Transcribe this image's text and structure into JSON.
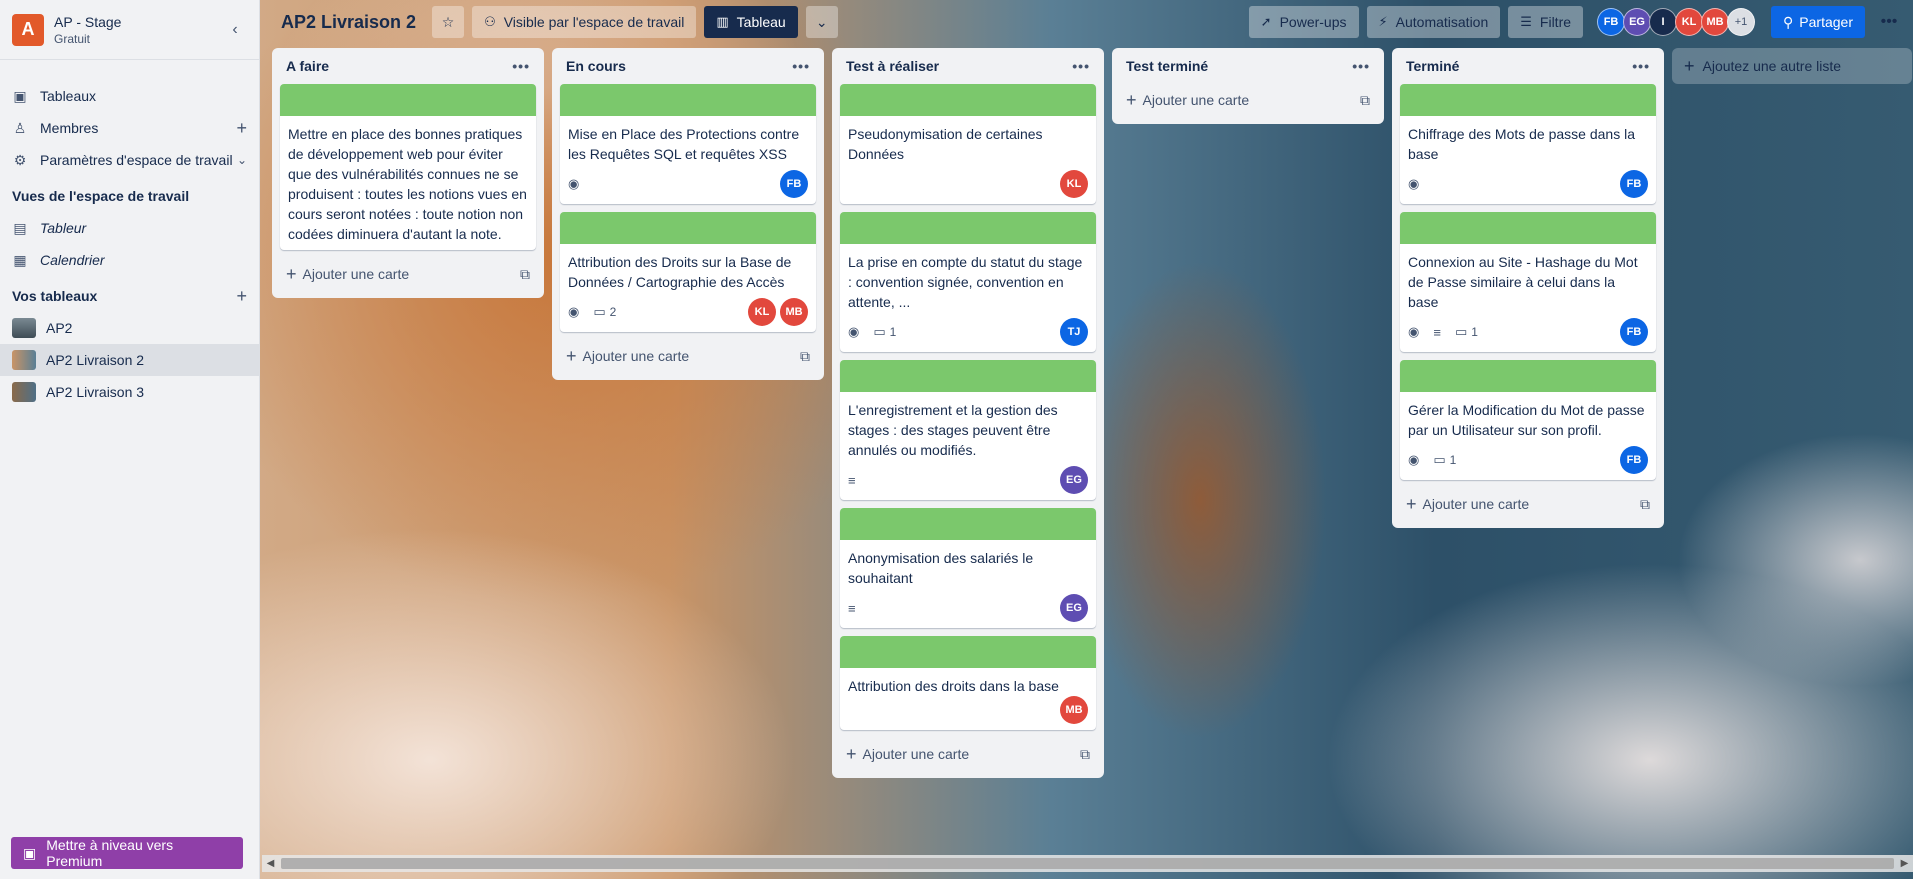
{
  "workspace": {
    "initial": "A",
    "name": "AP - Stage",
    "plan": "Gratuit"
  },
  "sidebar": {
    "items": [
      {
        "label": "Tableaux",
        "icon": "trello-icon"
      },
      {
        "label": "Membres",
        "icon": "person-icon"
      },
      {
        "label": "Paramètres d'espace de travail",
        "icon": "gear-icon"
      }
    ],
    "views_title": "Vues de l'espace de travail",
    "views": [
      {
        "label": "Tableur",
        "icon": "table-icon"
      },
      {
        "label": "Calendrier",
        "icon": "calendar-icon"
      }
    ],
    "boards_title": "Vos tableaux",
    "boards": [
      {
        "label": "AP2"
      },
      {
        "label": "AP2 Livraison 2"
      },
      {
        "label": "AP2 Livraison 3"
      }
    ],
    "premium_label": "Mettre à niveau vers Premium"
  },
  "topbar": {
    "title": "AP2 Livraison 2",
    "visibility": "Visible par l'espace de travail",
    "view": "Tableau",
    "powerups": "Power-ups",
    "automation": "Automatisation",
    "filter": "Filtre",
    "members": [
      {
        "initials": "FB",
        "color": "#0c66e4"
      },
      {
        "initials": "EG",
        "color": "#5e4db2"
      },
      {
        "initials": "I",
        "color": "#172b4d"
      },
      {
        "initials": "KL",
        "color": "#e2483d"
      },
      {
        "initials": "MB",
        "color": "#e2483d"
      }
    ],
    "more_members": "+1",
    "share": "Partager"
  },
  "add_card_label": "Ajouter une carte",
  "add_list_label": "Ajoutez une autre liste",
  "lists": [
    {
      "title": "A faire",
      "cards": [
        {
          "text": "Mettre en place des bonnes pratiques de développement web pour éviter que des vulnérabilités connues ne se produisent : toutes les notions vues en cours seront notées : toute notion non codées diminuera d'autant la note."
        }
      ]
    },
    {
      "title": "En cours",
      "cards": [
        {
          "text": "Mise en Place des Protections contre les Requêtes SQL et requêtes XSS",
          "comments": ""
        },
        {
          "text": "Attribution des Droits sur la Base de Données / Cartographie des Accès",
          "comments": "2"
        }
      ]
    },
    {
      "title": "Test à réaliser",
      "cards": [
        {
          "text": "Pseudonymisation de certaines Données"
        },
        {
          "text": "La prise en compte du statut du stage : convention signée, convention en attente, ...",
          "comments": "1"
        },
        {
          "text": "L'enregistrement et la gestion des stages : des stages peuvent être annulés ou modifiés."
        },
        {
          "text": "Anonymisation des salariés le souhaitant"
        },
        {
          "text": "Attribution des droits dans la base"
        }
      ]
    },
    {
      "title": "Test terminé",
      "cards": []
    },
    {
      "title": "Terminé",
      "cards": [
        {
          "text": "Chiffrage des Mots de passe dans la base"
        },
        {
          "text": "Connexion au Site - Hashage du Mot de Passe similaire à celui dans la base",
          "comments": "1"
        },
        {
          "text": "Gérer la Modification du Mot de passe par un Utilisateur sur son profil.",
          "comments": "1"
        }
      ]
    }
  ]
}
